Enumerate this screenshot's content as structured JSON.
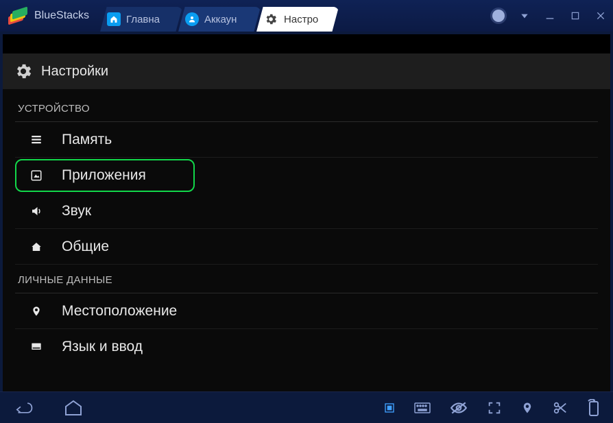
{
  "app": {
    "name": "BlueStacks"
  },
  "tabs": [
    {
      "label": "Главна",
      "icon": "home-icon"
    },
    {
      "label": "Аккаун",
      "icon": "account-icon"
    },
    {
      "label": "Настро",
      "icon": "settings-icon",
      "active": true
    }
  ],
  "settings": {
    "title": "Настройки",
    "sections": [
      {
        "label": "УСТРОЙСТВО",
        "items": [
          {
            "label": "Память",
            "icon": "memory-icon"
          },
          {
            "label": "Приложения",
            "icon": "apps-icon",
            "highlighted": true
          },
          {
            "label": "Звук",
            "icon": "sound-icon"
          },
          {
            "label": "Общие",
            "icon": "home-small-icon"
          }
        ]
      },
      {
        "label": "ЛИЧНЫЕ ДАННЫЕ",
        "items": [
          {
            "label": "Местоположение",
            "icon": "location-icon"
          },
          {
            "label": "Язык и ввод",
            "icon": "language-icon"
          }
        ]
      }
    ]
  }
}
